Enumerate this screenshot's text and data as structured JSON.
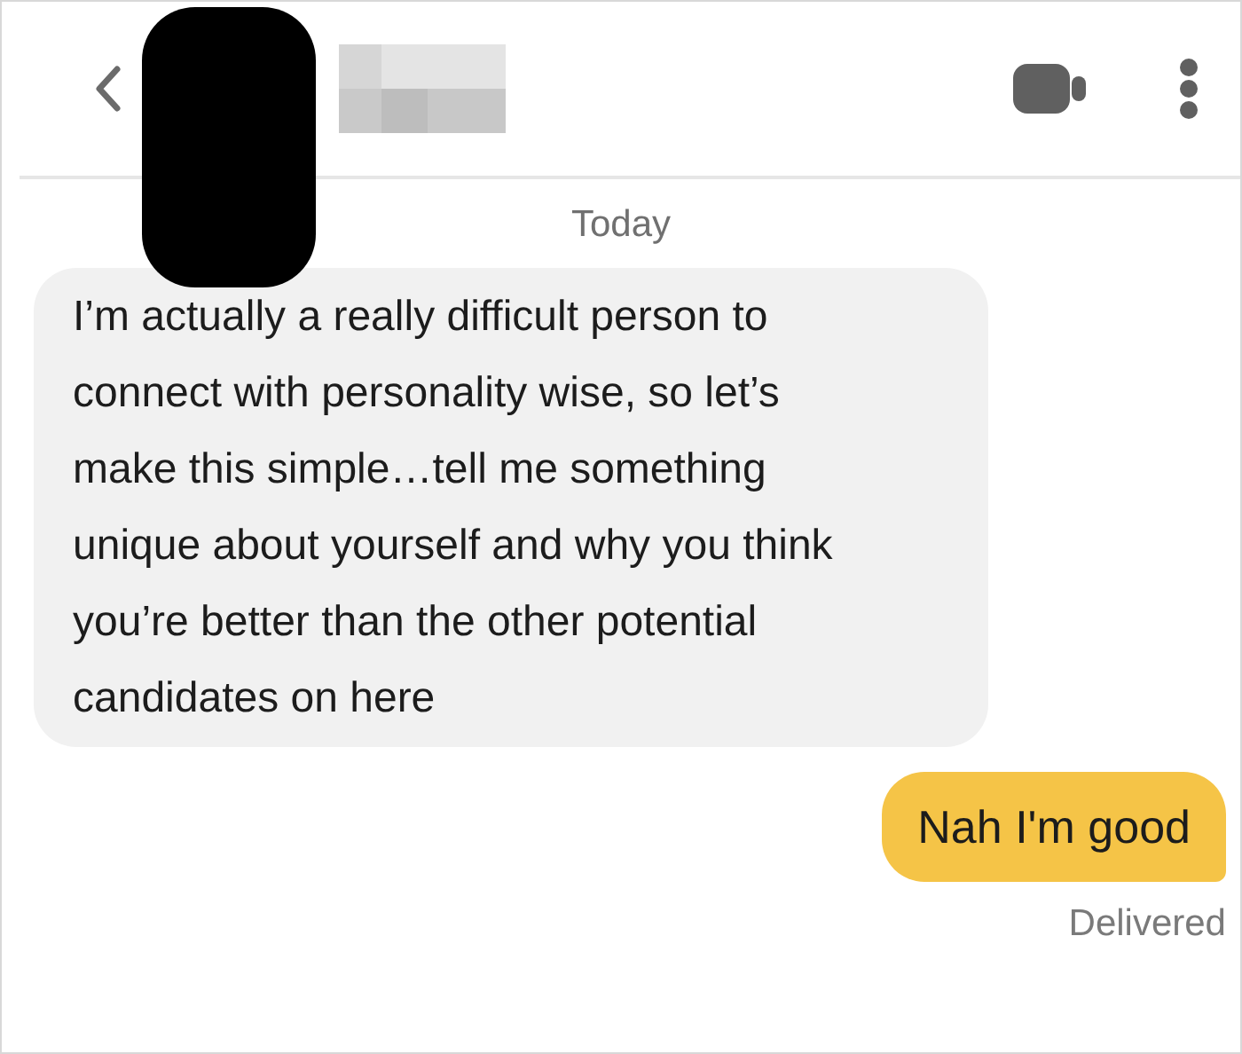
{
  "day_label": "Today",
  "messages": [
    {
      "kind": "incoming",
      "text": "I’m actually a really difficult person to connect with personality wise, so let’s make this simple…tell me something unique about yourself and why you think you’re better than the other potential candidates on here"
    },
    {
      "kind": "outgoing",
      "text": "Nah I'm good"
    }
  ],
  "status": "Delivered"
}
